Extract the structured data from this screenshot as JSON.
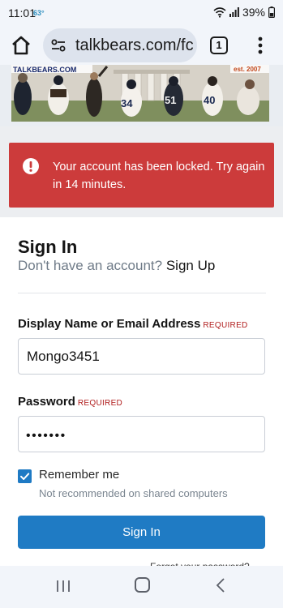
{
  "status_bar": {
    "time": "11:01",
    "temperature": "63°",
    "battery": "39%",
    "icons": [
      "wifi-icon",
      "signal-icon",
      "battery-icon"
    ]
  },
  "browser": {
    "url": "talkbears.com/fc",
    "tab_count": "1",
    "icons": [
      "home-icon",
      "site-settings-icon",
      "tabs-icon",
      "more-vert-icon"
    ]
  },
  "banner": {
    "logo_text": "TALKBEARS.COM",
    "est_text": "est. 2007"
  },
  "alert": {
    "icon": "exclamation-circle-icon",
    "message": "Your account has been locked. Try again in 14 minutes.",
    "background_color": "#cc3b3b"
  },
  "signin": {
    "title": "Sign In",
    "no_account_text": "Don't have an account?",
    "signup_link": "Sign Up",
    "username_label": "Display Name or Email Address",
    "username_required": "REQUIRED",
    "username_value": "Mongo3451",
    "password_label": "Password",
    "password_required": "REQUIRED",
    "password_masked": "•••••••",
    "remember_label": "Remember me",
    "remember_checked": true,
    "remember_hint": "Not recommended on shared computers",
    "submit_label": "Sign In",
    "forgot_partial": "Forgot your password?",
    "accent_color": "#1f7bc4"
  },
  "navbar": {
    "icons": [
      "recents-icon",
      "home-nav-icon",
      "back-icon"
    ]
  }
}
